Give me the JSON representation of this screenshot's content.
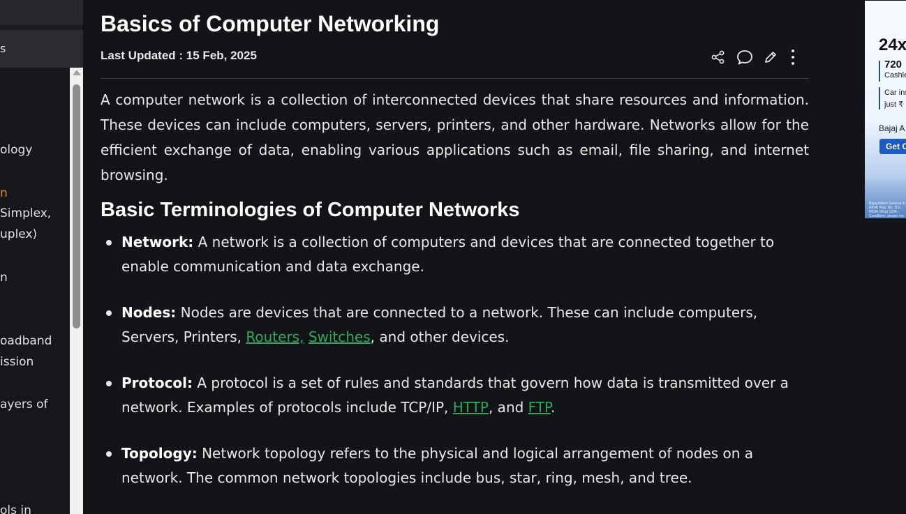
{
  "sidebar": {
    "tab_label": "s",
    "items": [
      {
        "label": "ology"
      },
      {
        "label": "n"
      },
      {
        "label": "Simplex,"
      },
      {
        "label": "uplex)"
      },
      {
        "label": "n"
      },
      {
        "label": "oadband"
      },
      {
        "label": "ission"
      },
      {
        "label": "ayers of"
      },
      {
        "label": "ols in"
      }
    ]
  },
  "article": {
    "title": "Basics of Computer Networking",
    "updated_label": "Last Updated : ",
    "updated_date": "15 Feb, 2025",
    "intro": "A computer network is a collection of interconnected devices that share resources and information. These devices can include computers, servers, printers, and other hardware. Networks allow for the efficient exchange of data, enabling various applications such as email, file sharing, and internet browsing.",
    "section_heading": "Basic Terminologies of Computer Networks",
    "terms": [
      {
        "term": "Network:",
        "text": " A network is a collection of computers and devices that are connected together to enable communication and data exchange."
      },
      {
        "term": "Nodes:",
        "text_before": " Nodes are devices that are connected to a network. These can include computers, Servers, Printers, ",
        "link1": "Routers,",
        "between": " ",
        "link2": "Switches",
        "text_after": ", and other devices."
      },
      {
        "term": "Protocol:",
        "text_before": " A protocol is a set of rules and standards that govern how data is transmitted over a network. Examples of protocols include TCP/IP, ",
        "link1": "HTTP",
        "between": ", and ",
        "link2": "FTP",
        "text_after": "."
      },
      {
        "term": "Topology:",
        "text": " Network topology refers to the physical and logical arrangement of nodes on a network. The common network topologies include bus, star, ring, mesh, and tree."
      }
    ]
  },
  "actions": {
    "icons": [
      "share-icon",
      "comment-icon",
      "edit-icon",
      "more-icon"
    ]
  },
  "ad": {
    "headline": "24x",
    "amount": "720",
    "line1": "Cashle",
    "line2": "Car ins",
    "line3": "just ₹",
    "brand": "Bajaj A",
    "cta": "Get C",
    "fine": "Bajaj Allianz General In\nIRDAI Reg. No. 113...\nIRDAI (Reg) 1234...\nConditions, please rea"
  },
  "colors": {
    "background": "#131417",
    "link": "#2fa85f",
    "sidebar_active": "#e08a3a"
  }
}
